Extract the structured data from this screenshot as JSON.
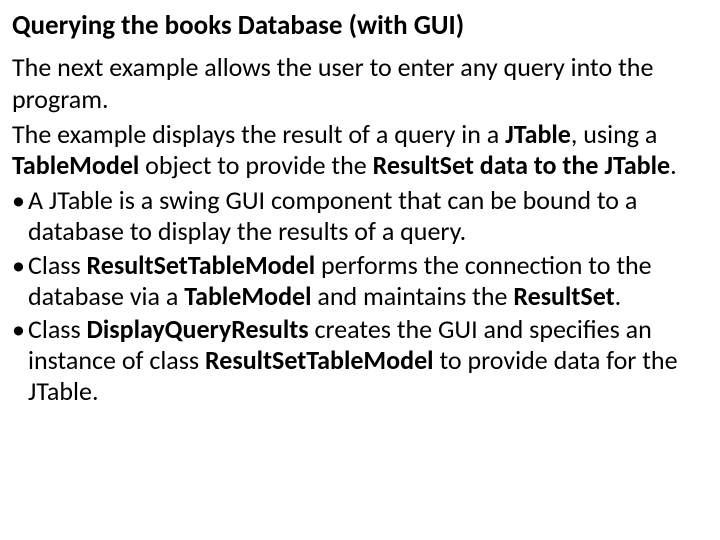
{
  "heading": "Querying the books Database (with GUI)",
  "p1": "The next example allows the user to enter any query into the program.",
  "p2_a": "The example displays the result of a query in a ",
  "p2_b": "JTable",
  "p2_c": ", using a ",
  "p2_d": "TableModel",
  "p2_e": " object to provide the ",
  "p2_f": "ResultSet data to the JTable",
  "p2_g": ".",
  "b1": "A JTable is a swing GUI component that can be bound to a database to display the results of a query.",
  "b2_a": "Class ",
  "b2_b": "ResultSetTableModel",
  "b2_c": " performs the connection to the database via a ",
  "b2_d": "TableModel",
  "b2_e": " and maintains the ",
  "b2_f": "ResultSet",
  "b2_g": ".",
  "b3_a": "Class ",
  "b3_b": "DisplayQueryResults",
  "b3_c": " creates the GUI and specifies an instance of class ",
  "b3_d": "ResultSetTableModel",
  "b3_e": " to provide data for the JTable."
}
